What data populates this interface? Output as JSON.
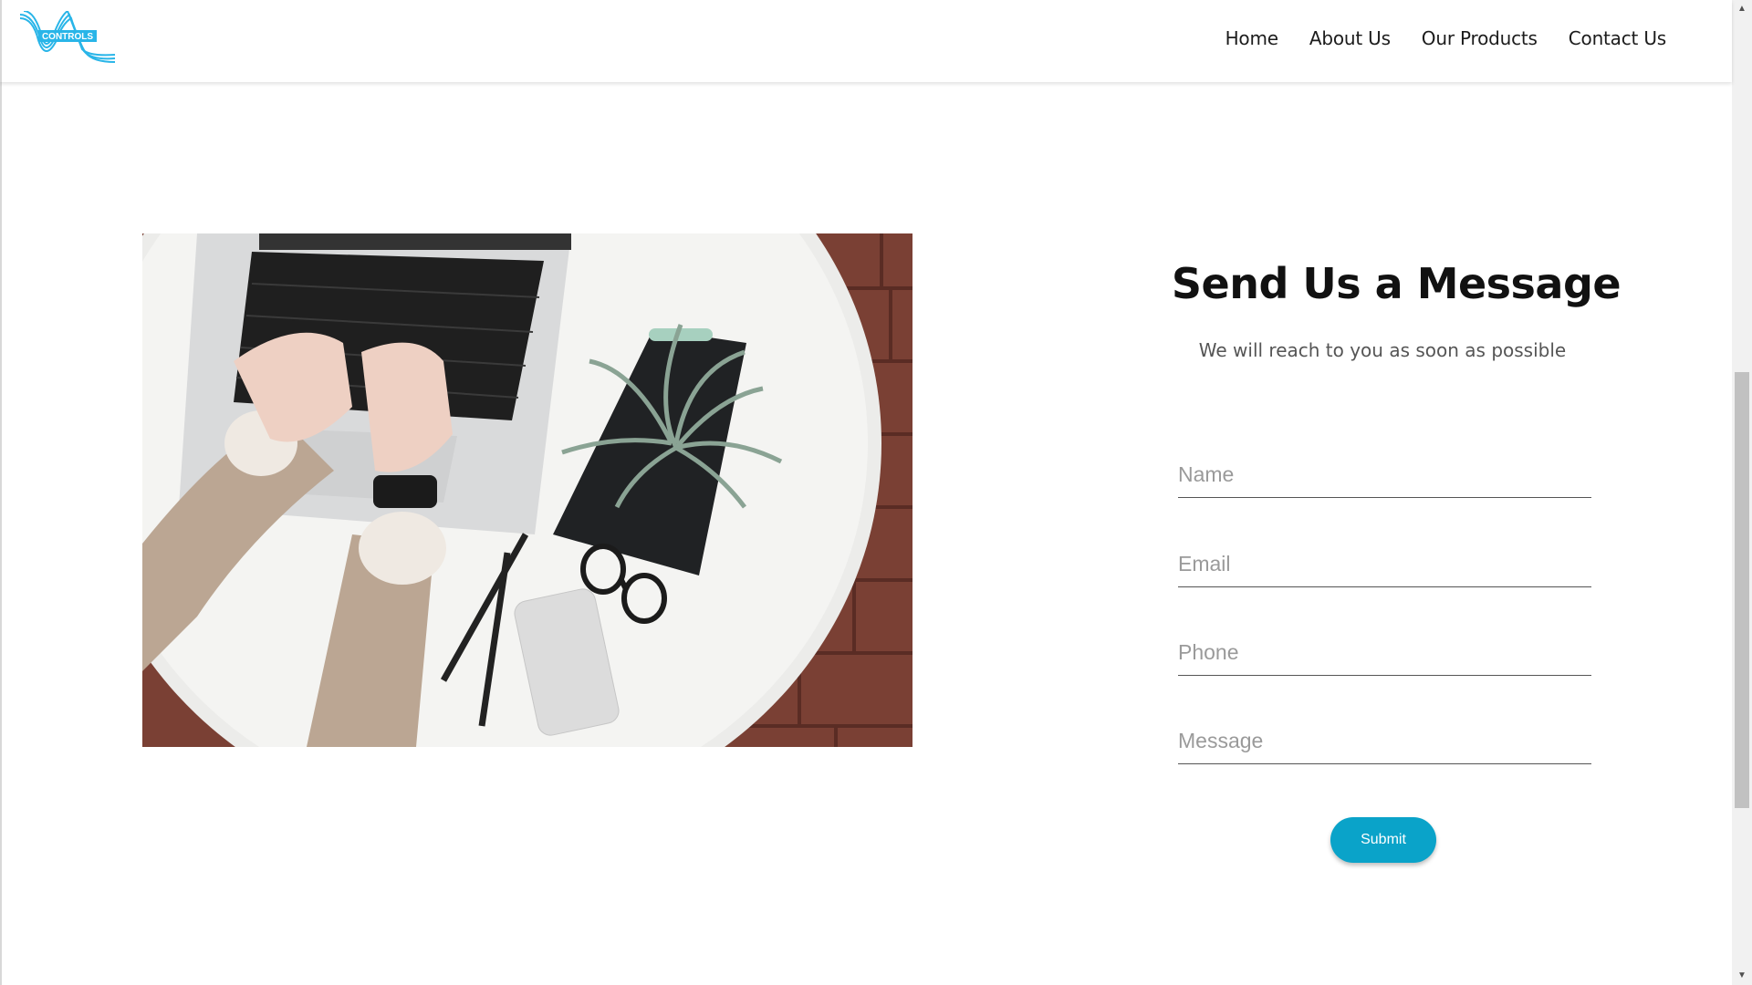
{
  "brand": {
    "logo_text": "CONTROLS",
    "accent_color": "#29b5e8"
  },
  "nav": {
    "items": [
      "Home",
      "About Us",
      "Our Products",
      "Contact Us"
    ]
  },
  "photo": {
    "icon": "laptop-desk-photo"
  },
  "form": {
    "title": "Send Us a Message",
    "subtitle": "We will reach to you as soon as possible",
    "name_placeholder": "Name",
    "email_placeholder": "Email",
    "phone_placeholder": "Phone",
    "message_placeholder": "Message",
    "submit_label": "Submit",
    "submit_color": "#0aa3c9"
  },
  "scrollbar": {
    "up_icon": "▲",
    "down_icon": "▼"
  }
}
